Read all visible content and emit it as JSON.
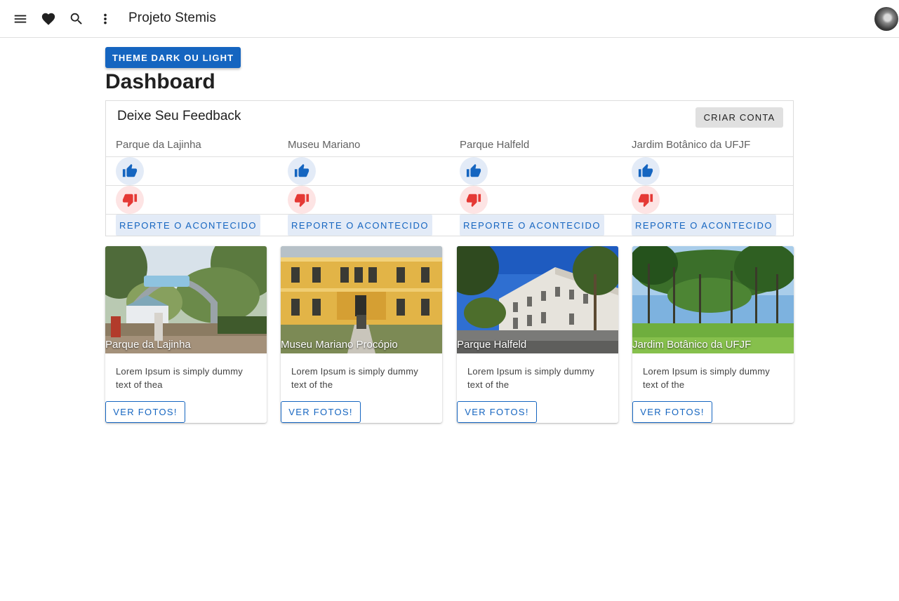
{
  "appbar": {
    "menu_icon": "menu-icon",
    "favorite_icon": "heart-icon",
    "search_icon": "search-icon",
    "more_icon": "more-vert-icon",
    "title": "Projeto Stemis"
  },
  "theme_button": "THEME DARK OU LIGHT",
  "page_title": "Dashboard",
  "feedback": {
    "title": "Deixe Seu Feedback",
    "create_account": "CRIAR CONTA",
    "places": [
      {
        "name": "Parque da Lajinha",
        "report": "REPORTE O ACONTECIDO"
      },
      {
        "name": "Museu Mariano",
        "report": "REPORTE O ACONTECIDO"
      },
      {
        "name": "Parque Halfeld",
        "report": "REPORTE O ACONTECIDO"
      },
      {
        "name": "Jardim Botânico da UFJF",
        "report": "REPORTE O ACONTECIDO"
      }
    ],
    "up_icon": "thumb-up-icon",
    "down_icon": "thumb-down-icon"
  },
  "cards": [
    {
      "caption": "Parque da Lajinha",
      "description": "Lorem Ipsum is simply dummy text of thea",
      "button": "VER FOTOS!"
    },
    {
      "caption": "Museu Mariano Procópio",
      "description": "Lorem Ipsum is simply dummy text of the",
      "button": "VER FOTOS!"
    },
    {
      "caption": "Parque Halfeld",
      "description": "Lorem Ipsum is simply dummy text of the",
      "button": "VER FOTOS!"
    },
    {
      "caption": "Jardim Botânico da UFJF",
      "description": "Lorem Ipsum is simply dummy text of the",
      "button": "VER FOTOS!"
    }
  ],
  "colors": {
    "primary": "#1565c0",
    "like_bg": "#e3ebf7",
    "dislike": "#e53935",
    "dislike_bg": "#fde4e4"
  }
}
